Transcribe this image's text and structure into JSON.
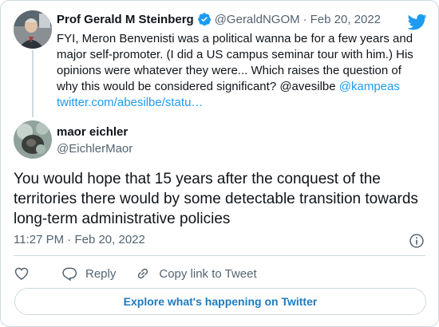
{
  "colors": {
    "accent": "#1d9bf0",
    "text": "#0f1419",
    "muted": "#536471",
    "border": "#cfd9de"
  },
  "parent_tweet": {
    "author_name": "Prof Gerald M Steinberg",
    "handle": "@GeraldNGOM",
    "separator": "·",
    "date": "Feb 20, 2022",
    "text": "FYI, Meron Benvenisti was a political wanna be for a few years and major self-promoter. (I did a US  campus seminar tour with him.) His opinions were whatever they were... Which raises the question of why this would be considered significant? @avesilbe ",
    "mention_link": "@kampeas",
    "url_link": "twitter.com/abesilbe/statu…",
    "verified_icon": "verified-badge-icon"
  },
  "tweet": {
    "author_name": "maor eichler",
    "handle": "@EichlerMaor",
    "text": "You would hope that 15 years after the conquest of the territories there would by some detectable transition towards long-term administrative policies",
    "time": "11:27 PM",
    "separator": "·",
    "date": "Feb 20, 2022"
  },
  "actions": {
    "like_icon": "heart-icon",
    "reply_label": "Reply",
    "copy_label": "Copy link to Tweet"
  },
  "explore_label": "Explore what's happening on Twitter"
}
